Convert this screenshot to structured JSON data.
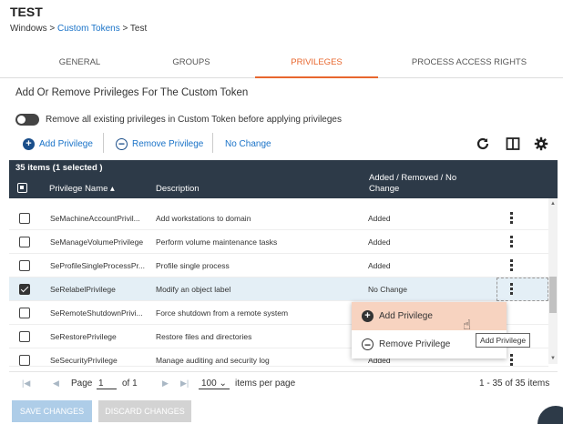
{
  "page": {
    "title": "TEST",
    "breadcrumb": {
      "part1": "Windows > ",
      "link": "Custom Tokens",
      "part2": " > Test"
    }
  },
  "tabs": [
    {
      "label": "GENERAL"
    },
    {
      "label": "GROUPS"
    },
    {
      "label": "PRIVILEGES",
      "active": true
    },
    {
      "label": "PROCESS ACCESS RIGHTS"
    }
  ],
  "section_title": "Add Or Remove Privileges For The Custom Token",
  "toggle": {
    "label": "Remove all existing privileges in Custom Token before applying privileges",
    "on": false
  },
  "toolbar": {
    "add": "Add Privilege",
    "remove": "Remove Privilege",
    "no_change": "No Change",
    "icons": [
      "refresh-icon",
      "columns-icon",
      "gear-icon"
    ]
  },
  "grid": {
    "count": "35 items (1 selected )",
    "columns": {
      "name": "Privilege Name ▴",
      "description": "Description",
      "status_line1": "Added / Removed / No",
      "status_line2": "Change"
    },
    "rows": [
      {
        "name": "SeMachineAccountPrivil...",
        "description": "Add workstations to domain",
        "status": "Added",
        "checked": false
      },
      {
        "name": "SeManageVolumePrivilege",
        "description": "Perform volume maintenance tasks",
        "status": "Added",
        "checked": false
      },
      {
        "name": "SeProfileSingleProcessPr...",
        "description": "Profile single process",
        "status": "Added",
        "checked": false
      },
      {
        "name": "SeRelabelPrivilege",
        "description": "Modify an object label",
        "status": "No Change",
        "checked": true
      },
      {
        "name": "SeRemoteShutdownPrivi...",
        "description": "Force shutdown from a remote system",
        "status": "",
        "checked": false
      },
      {
        "name": "SeRestorePrivilege",
        "description": "Restore files and directories",
        "status": "",
        "checked": false
      },
      {
        "name": "SeSecurityPrivilege",
        "description": "Manage auditing and security log",
        "status": "Added",
        "checked": false
      }
    ]
  },
  "context_menu": {
    "add": "Add Privilege",
    "remove": "Remove Privilege"
  },
  "tooltip": "Add Privilege",
  "pager": {
    "page_label": "Page",
    "page_value": "1",
    "of_label": "of 1",
    "per_page_value": "100",
    "per_page_label": "items per page",
    "summary": "1 - 35 of 35 items"
  },
  "footer": {
    "save": "SAVE CHANGES",
    "discard": "DISCARD CHANGES"
  },
  "colors": {
    "accent": "#e8672e",
    "link": "#1a73c8",
    "header": "#2d3a48",
    "selected_row": "#e4eff6"
  }
}
